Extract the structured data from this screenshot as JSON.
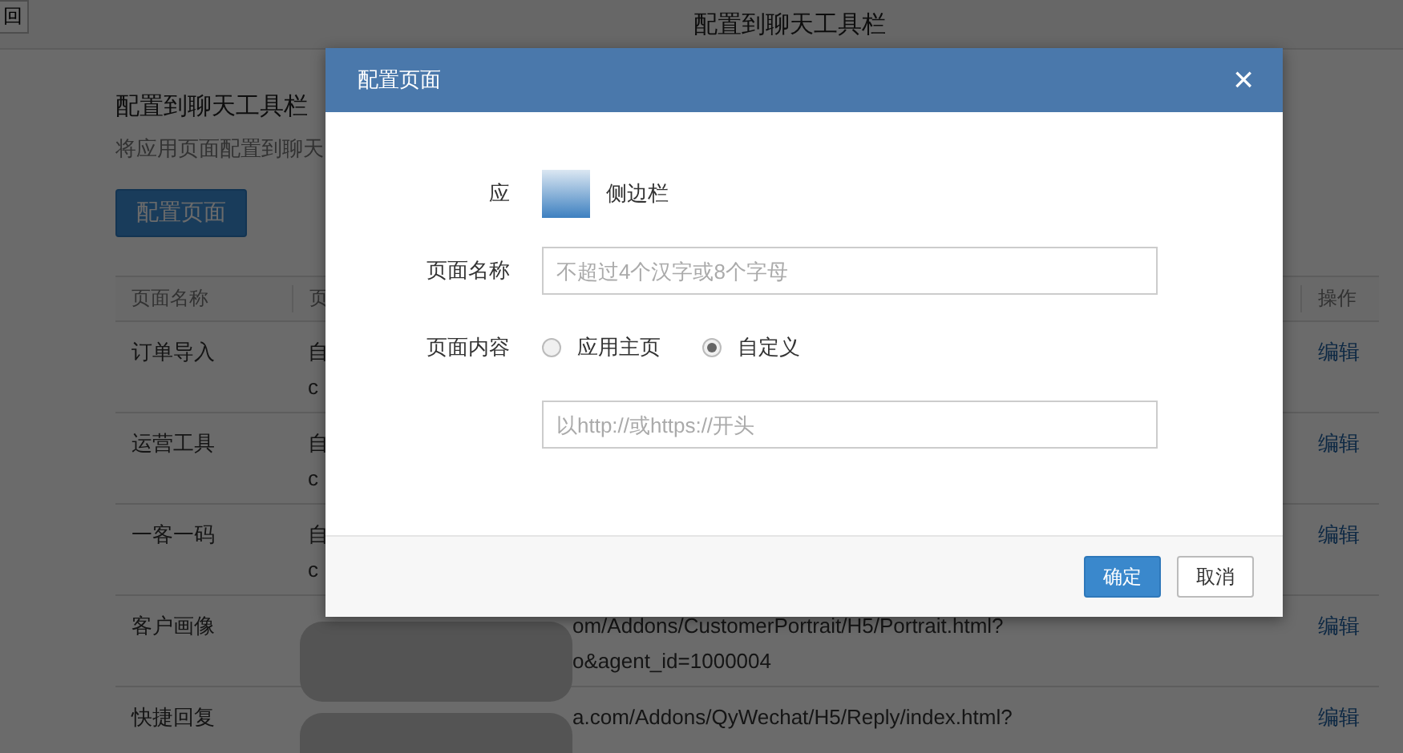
{
  "top_bar": {
    "back_button": "回",
    "title": "配置到聊天工具栏"
  },
  "section": {
    "heading": "配置到聊天工具栏",
    "description": "将应用页面配置到聊天",
    "button": "配置页面"
  },
  "table": {
    "columns": [
      "页面名称",
      "页",
      "操作"
    ],
    "rows": [
      {
        "name": "订单导入",
        "content": [
          "自",
          "c"
        ],
        "blurred": false,
        "action": "编辑"
      },
      {
        "name": "运营工具",
        "content": [
          "自",
          "c"
        ],
        "blurred": false,
        "action": "编辑"
      },
      {
        "name": "一客一码",
        "content": [
          "自",
          "c"
        ],
        "blurred": false,
        "action": "编辑"
      },
      {
        "name": "客户画像",
        "content": [
          "om/Addons/CustomerPortrait/H5/Portrait.html?",
          "o&agent_id=1000004"
        ],
        "blurred": true,
        "action": "编辑"
      },
      {
        "name": "快捷回复",
        "content": [
          "a.com/Addons/QyWechat/H5/Reply/index.html?"
        ],
        "blurred": true,
        "action": "编辑"
      }
    ]
  },
  "dialog": {
    "title": "配置页面",
    "close": "×",
    "app_row": {
      "label": "应",
      "value": "侧边栏"
    },
    "name_field": {
      "label": "页面名称",
      "placeholder": "不超过4个汉字或8个字母"
    },
    "content_field": {
      "label": "页面内容",
      "options": [
        {
          "label": "应用主页",
          "selected": false
        },
        {
          "label": "自定义",
          "selected": true
        }
      ],
      "placeholder": "以http://或https://开头"
    },
    "buttons": [
      {
        "label": "确定",
        "kind": "primary"
      },
      {
        "label": "取消",
        "kind": "default"
      }
    ]
  }
}
